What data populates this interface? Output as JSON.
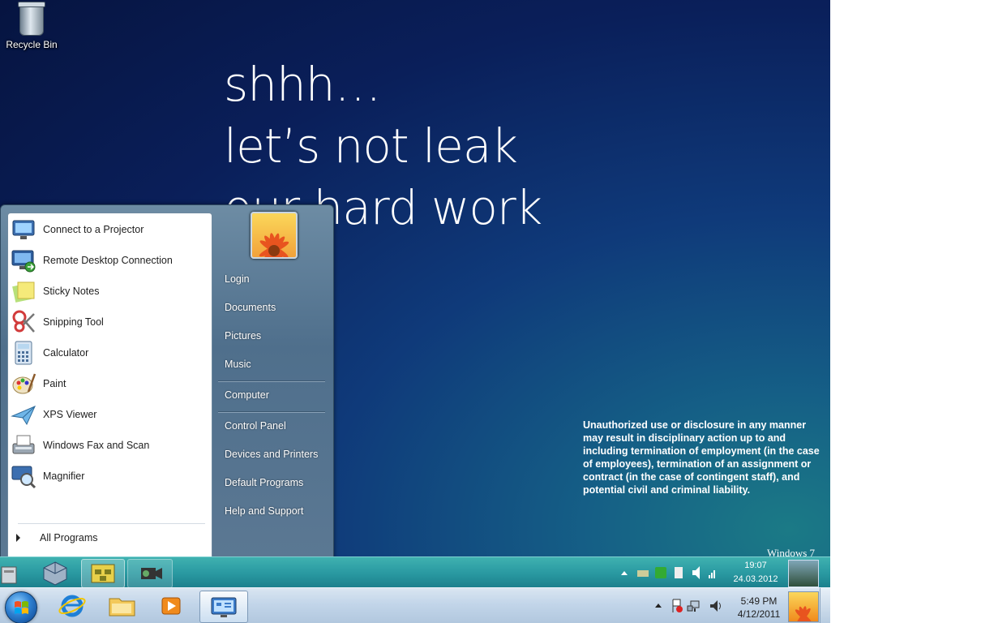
{
  "desktop": {
    "recycle_bin": "Recycle Bin",
    "slogan": [
      "shhh…",
      "let’s not leak",
      "our hard work"
    ],
    "legal": "Unauthorized use or disclosure in any manner may result in disciplinary action up to and including termination of employment (in the case of employees), termination of an assignment or contract (in the case of contingent staff), and potential civil and criminal liability.",
    "watermark": "Windows 7"
  },
  "start_menu": {
    "programs": [
      {
        "label": "Connect to a Projector",
        "icon": "projector-icon"
      },
      {
        "label": "Remote Desktop Connection",
        "icon": "remote-desktop-icon"
      },
      {
        "label": "Sticky Notes",
        "icon": "sticky-notes-icon"
      },
      {
        "label": "Snipping Tool",
        "icon": "scissors-icon"
      },
      {
        "label": "Calculator",
        "icon": "calculator-icon"
      },
      {
        "label": "Paint",
        "icon": "palette-icon"
      },
      {
        "label": "XPS Viewer",
        "icon": "paper-plane-icon"
      },
      {
        "label": "Windows Fax and Scan",
        "icon": "fax-icon"
      },
      {
        "label": "Magnifier",
        "icon": "magnifier-icon"
      }
    ],
    "all_programs": "All Programs",
    "right_links": [
      "Login",
      "Documents",
      "Pictures",
      "Music",
      "Computer",
      "Control Panel",
      "Devices and Printers",
      "Default Programs",
      "Help and Support"
    ]
  },
  "vm_taskbar": {
    "time": "19:07",
    "date": "24.03.2012"
  },
  "host_taskbar": {
    "time": "5:49 PM",
    "date": "4/12/2011",
    "pinned": [
      "internet-explorer-icon",
      "folder-icon",
      "media-player-icon",
      "remote-session-icon"
    ]
  },
  "colors": {
    "desktop_dark": "#061440",
    "desktop_teal": "#1b7a86",
    "vm_taskbar": "#2a9aa2",
    "host_taskbar": "#c2d5e9"
  }
}
